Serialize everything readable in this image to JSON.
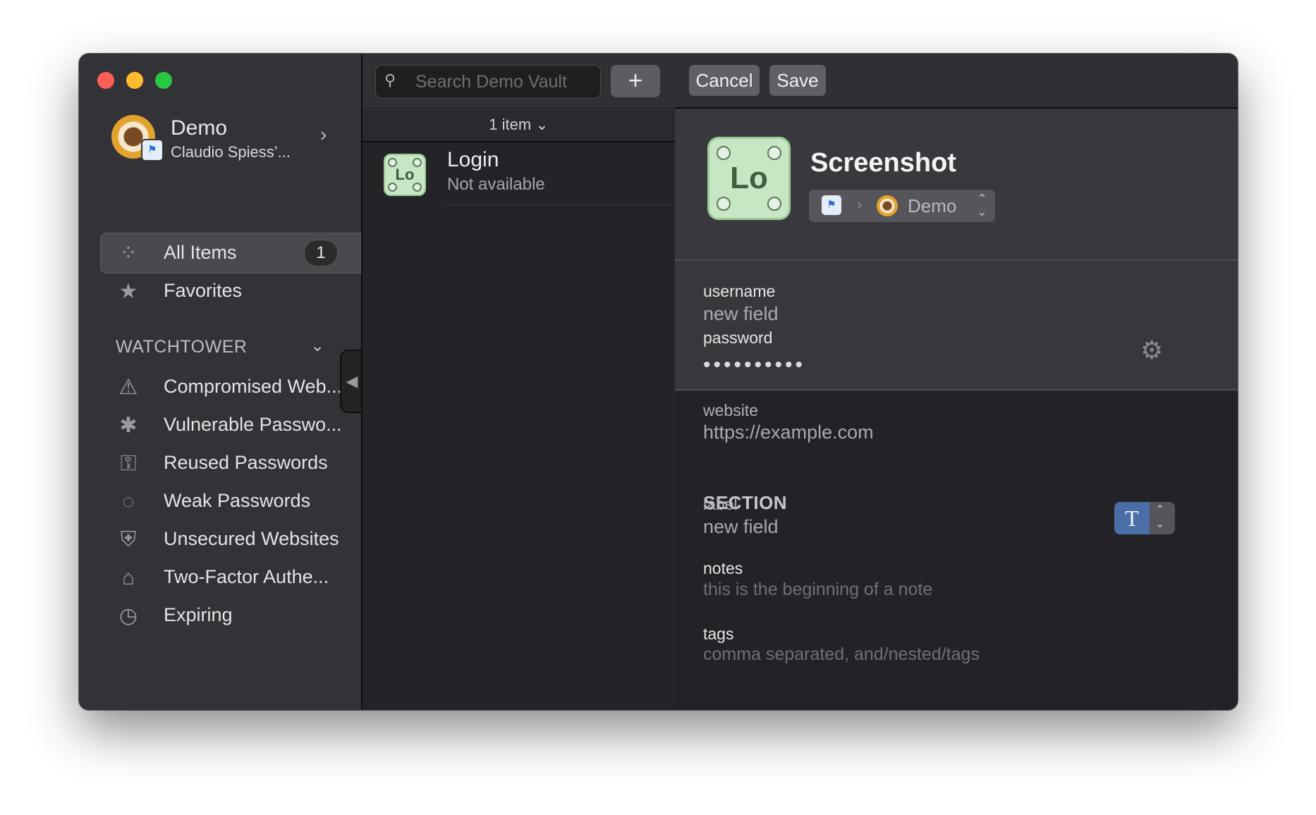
{
  "window": {
    "traffic_lights": {
      "close": "#fe5f57",
      "minimize": "#febc2e",
      "zoom": "#28c840"
    }
  },
  "account": {
    "name": "Demo",
    "subtitle": "Claudio Spiess’...",
    "chevron": "›"
  },
  "sidebar": {
    "items": [
      {
        "label": "All Items",
        "icon": "all-items-icon",
        "glyph": "⁘",
        "count": "1"
      },
      {
        "label": "Favorites",
        "icon": "star-icon",
        "glyph": "★"
      }
    ],
    "watchtower": {
      "header": "WATCHTOWER",
      "chevron": "⌄",
      "items": [
        {
          "label": "Compromised Web...",
          "icon": "warning-icon",
          "glyph": "⚠"
        },
        {
          "label": "Vulnerable Passwo...",
          "icon": "vulnerable-key-icon",
          "glyph": "✱"
        },
        {
          "label": "Reused Passwords",
          "icon": "keys-icon",
          "glyph": "⚿"
        },
        {
          "label": "Weak Passwords",
          "icon": "weak-ring-icon",
          "glyph": "◌"
        },
        {
          "label": "Unsecured Websites",
          "icon": "shield-x-icon",
          "glyph": "⛨"
        },
        {
          "label": "Two-Factor Authe...",
          "icon": "two-factor-icon",
          "glyph": "⌂"
        },
        {
          "label": "Expiring",
          "icon": "clock-icon",
          "glyph": "◷"
        }
      ]
    },
    "collapse_glyph": "◀"
  },
  "list": {
    "search_placeholder": "Search Demo Vault",
    "search_glyph": "⚲",
    "add_glyph": "+",
    "count_label": "1 item ⌄",
    "items": [
      {
        "thumb": "Lo",
        "title": "Login",
        "subtitle": "Not available"
      }
    ]
  },
  "detail": {
    "cancel_label": "Cancel",
    "save_label": "Save",
    "icon_text": "Lo",
    "title": "Screenshot",
    "vault_picker": {
      "flag": "⚑",
      "arrow": "›",
      "name": "Demo",
      "stepper": "⌃⌄"
    },
    "fields": {
      "username_label": "username",
      "username_value": "new field",
      "password_label": "password",
      "password_value": "••••••••••",
      "gear_glyph": "⚙",
      "website_label": "website",
      "website_value": "https://example.com",
      "section_title": "SECTION",
      "custom_label": "label",
      "custom_value": "new field",
      "type_glyph": "T",
      "type_stepper": "⌃⌄",
      "notes_label": "notes",
      "notes_placeholder": "this is the beginning of a note",
      "tags_label": "tags",
      "tags_placeholder": "comma separated, and/nested/tags"
    }
  }
}
